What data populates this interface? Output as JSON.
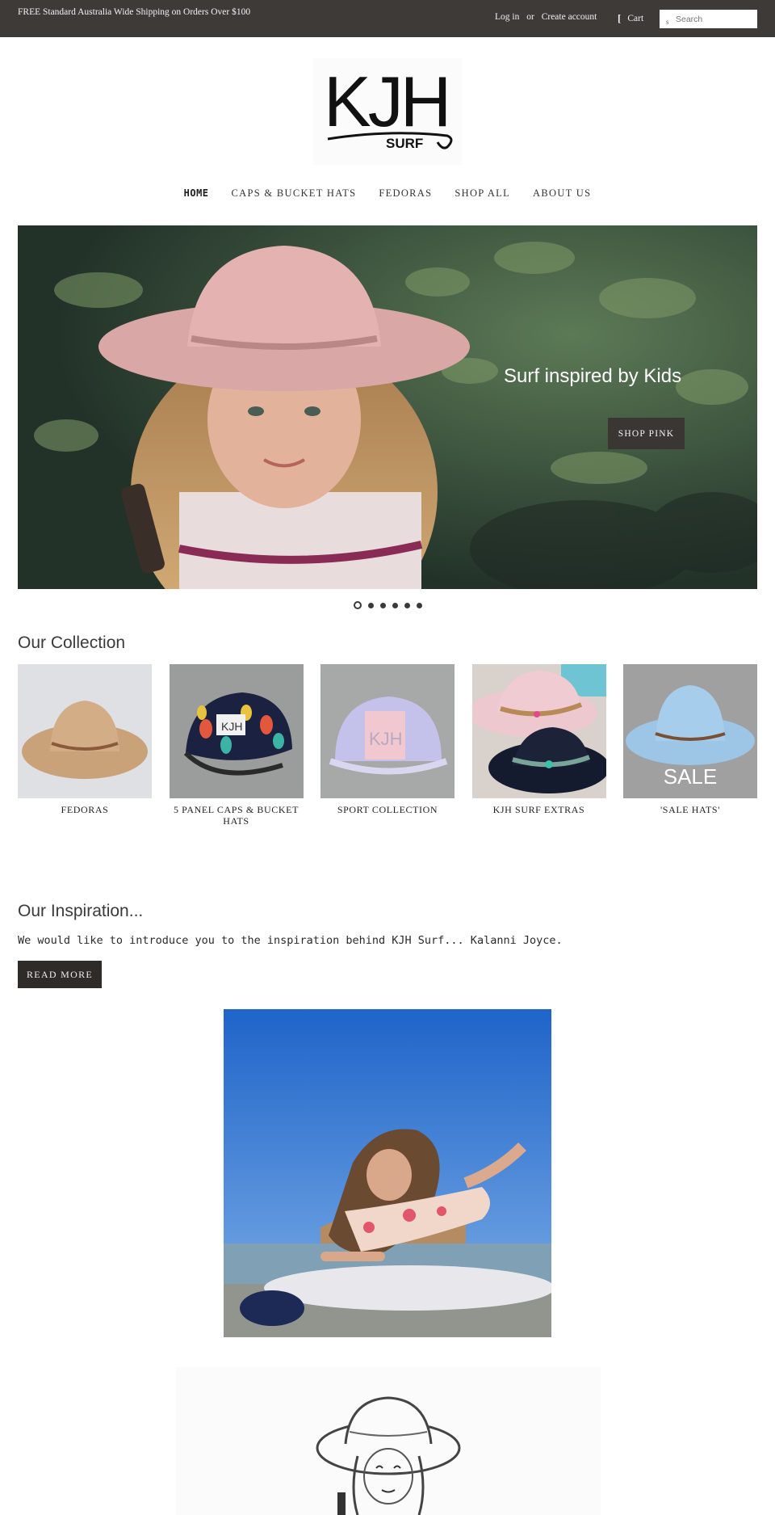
{
  "topbar": {
    "promo": "FREE Standard Australia Wide Shipping on Orders Over $100",
    "login": "Log in",
    "or": "or",
    "create_account": "Create account",
    "cart": "Cart",
    "search_placeholder": "Search"
  },
  "logo": {
    "text": "KJH",
    "subtext": "SURF"
  },
  "nav": {
    "items": [
      "HOME",
      "CAPS & BUCKET HATS",
      "FEDORAS",
      "SHOP ALL",
      "ABOUT US"
    ],
    "active": "HOME"
  },
  "hero": {
    "caption": "Surf inspired by Kids",
    "cta": "SHOP PINK",
    "slide_count": 6,
    "active_slide": 1
  },
  "collection": {
    "title": "Our Collection",
    "items": [
      {
        "label": "FEDORAS"
      },
      {
        "label": "5 PANEL CAPS & BUCKET HATS"
      },
      {
        "label": "SPORT COLLECTION"
      },
      {
        "label": "KJH SURF EXTRAS"
      },
      {
        "label": "'SALE HATS'",
        "overlay": "SALE"
      }
    ]
  },
  "inspiration": {
    "title": "Our Inspiration...",
    "intro": "We would like to introduce you to the inspiration behind KJH Surf... Kalanni Joyce.",
    "cta": "READ MORE"
  },
  "colors": {
    "topbar_bg": "#3e3a37",
    "button_bg": "#2e2b29",
    "text": "#2b2b2b"
  }
}
